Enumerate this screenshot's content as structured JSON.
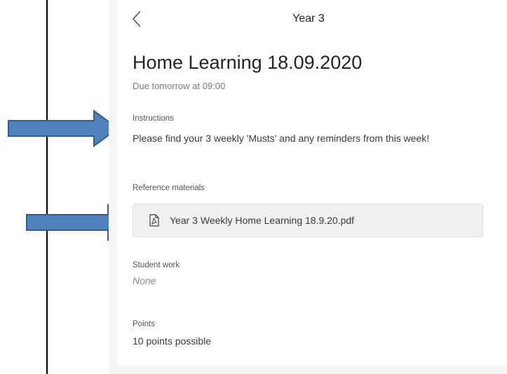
{
  "header": {
    "back_icon": "chevron-left-icon",
    "title": "Year 3"
  },
  "assignment": {
    "title": "Home Learning 18.09.2020",
    "due": "Due tomorrow at 09:00"
  },
  "instructions": {
    "label": "Instructions",
    "text": "Please find your 3 weekly 'Musts' and any reminders from this week!"
  },
  "reference": {
    "label": "Reference materials",
    "file_icon": "pdf-file-icon",
    "file_name": "Year 3 Weekly Home Learning 18.9.20.pdf"
  },
  "student_work": {
    "label": "Student work",
    "value": "None"
  },
  "points": {
    "label": "Points",
    "value": "10 points possible"
  },
  "annotations": {
    "arrow_color": "#4f81bd",
    "arrow_border": "#385d8a"
  }
}
